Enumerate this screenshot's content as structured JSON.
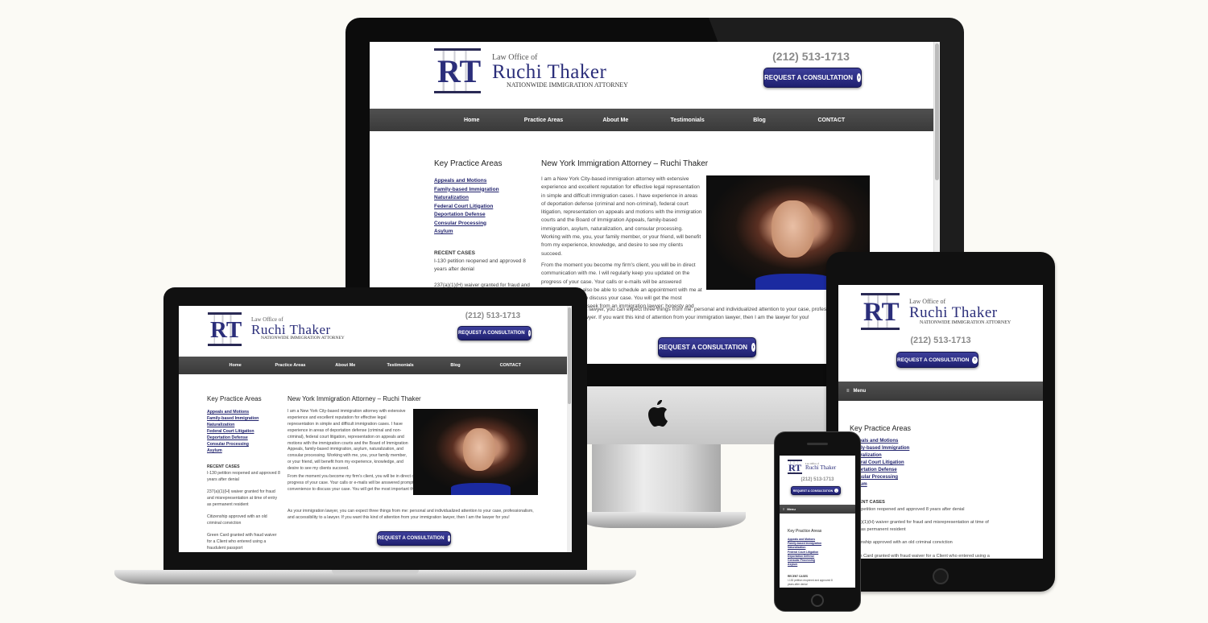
{
  "brand": {
    "monogram": "RT",
    "law_office": "Law Office of",
    "name": "Ruchi Thaker",
    "tagline": "Nationwide Immigration Attorney"
  },
  "header": {
    "phone": "(212) 513-1713",
    "cta_label": "REQUEST A CONSULTATION",
    "cta_icon": "arrow-right-circle-icon"
  },
  "nav": {
    "items": [
      "Home",
      "Practice Areas",
      "About Me",
      "Testimonials",
      "Blog",
      "CONTACT"
    ],
    "menu_label": "Menu",
    "menu_icon": "hamburger-icon"
  },
  "sidebar": {
    "heading": "Key Practice Areas",
    "links": [
      "Appeals and Motions",
      "Family-based Immigration",
      "Naturalization",
      "Federal Court Litigation",
      "Deportation Defense",
      "Consular Processing",
      "Asylum"
    ],
    "recent_heading": "RECENT CASES",
    "recent": [
      "I-130 petition reopened and approved 8 years after denial",
      "237(a)(1)(H) waiver granted for fraud and misrepresentation at time of entry as permanent resident",
      "Citizenship approved with an old criminal conviction",
      "Green Card granted with fraud waiver for a Client who entered using a fraudulent passport"
    ]
  },
  "main": {
    "title": "New York Immigration Attorney – Ruchi Thaker",
    "p1": "I am a New York City-based immigration attorney with extensive experience and excellent reputation for effective legal representation in simple and difficult immigration cases. I have experience in areas of deportation defense (criminal and non-criminal), federal court litigation, representation on appeals and motions with the immigration courts and the Board of Immigration Appeals, family-based immigration, asylum, naturalization, and consular processing. Working with me, you, your family member, or your friend, will benefit from my experience, knowledge, and desire to see my clients succeed.",
    "p2": "From the moment you become my firm's client, you will be in direct communication with me. I will regularly keep you updated on the progress of your case. Your calls or e-mails will be answered promptly. You will also be able to schedule an appointment with me at your convenience to discuss your case. You will get the most important thing you seek from an immigration lawyer: honesty and integrity.",
    "p3": "As your immigration lawyer, you can expect three things from me: personal and individualized attention to your case, professionalism, and accessibility to a lawyer. If you want this kind of attention from your immigration lawyer, then I am the lawyer for you!",
    "photo_alt": "attorney-portrait"
  },
  "devices": {
    "desktop_logo_icon": "apple-logo-icon"
  },
  "colors": {
    "background": "#fbfaf5",
    "navy": "#22246e",
    "nav_bar": "#444444",
    "phone_gray": "#8a8a8a"
  }
}
